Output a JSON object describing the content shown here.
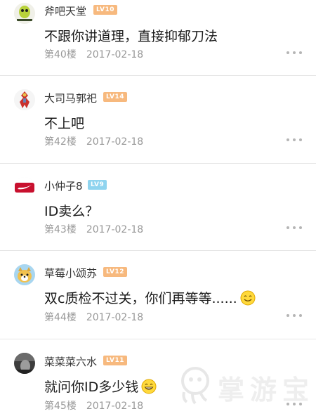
{
  "comments": [
    {
      "username": "斧吧天堂",
      "level": "LV10",
      "level_color": "#f7b97e",
      "avatar": "green-alien-avatar",
      "content": "不跟你讲道理，直接抑郁刀法",
      "floor": "第40楼",
      "date": "2017-02-18"
    },
    {
      "username": "大司马郭祀",
      "level": "LV14",
      "level_color": "#f7b97e",
      "avatar": "red-robot-avatar",
      "content": "不上吧",
      "floor": "第42楼",
      "date": "2017-02-18"
    },
    {
      "username": "小仲子8",
      "level": "LV9",
      "level_color": "#8fd4ef",
      "avatar": "nike-logo-avatar",
      "content": "ID卖么？",
      "floor": "第43楼",
      "date": "2017-02-18"
    },
    {
      "username": "草莓小颂苏",
      "level": "LV12",
      "level_color": "#f7b97e",
      "avatar": "dog-cartoon-avatar",
      "content": "双c质检不过关，你们再等等......",
      "emoji": "smile-emoji",
      "floor": "第44楼",
      "date": "2017-02-18"
    },
    {
      "username": "菜菜菜六水",
      "level": "LV11",
      "level_color": "#f7b97e",
      "avatar": "dark-photo-avatar",
      "content": "就问你ID多少钱",
      "emoji": "grin-emoji",
      "floor": "第45楼",
      "date": "2017-02-18"
    }
  ],
  "watermark": {
    "text": "掌游宝",
    "icon": "octopus-logo-icon"
  },
  "colors": {
    "background": "#ffffff",
    "divider": "#e6e6e6",
    "meta_text": "#999999",
    "content_text": "#1a1a1a"
  }
}
